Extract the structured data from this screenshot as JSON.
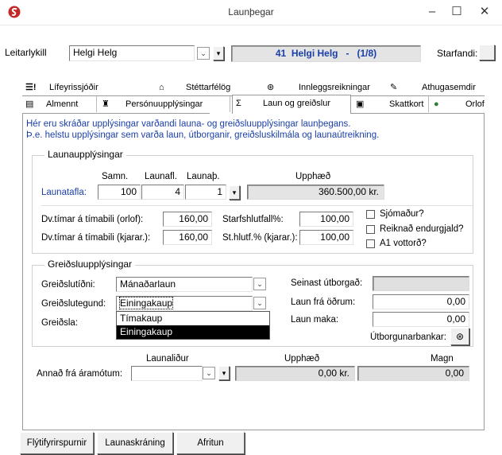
{
  "window": {
    "title": "Launþegar",
    "minimize": "–",
    "maximize": "☐",
    "close": "✕"
  },
  "search": {
    "label": "Leitarlykill",
    "value": "Helgi Helg",
    "current": "41  Helgi Helg   -   (1/8)",
    "status_label": "Starfandi:"
  },
  "tabs_row1": [
    {
      "label": "Lífeyrissjóðir",
      "icon": "pension-icon"
    },
    {
      "label": "Stéttarfélög",
      "icon": "union-icon"
    },
    {
      "label": "Innleggsreikningar",
      "icon": "deposit-icon"
    },
    {
      "label": "Athugasemdir",
      "icon": "notes-icon"
    }
  ],
  "tabs_row2": [
    {
      "label": "Almennt",
      "icon": "general-icon"
    },
    {
      "label": "Persónuupplýsingar",
      "icon": "person-icon"
    },
    {
      "label": "Laun og greiðslur",
      "icon": "sigma-icon",
      "glyph": "Σ"
    },
    {
      "label": "Skattkort",
      "icon": "taxcard-icon"
    },
    {
      "label": "Orlof",
      "icon": "globe-icon"
    }
  ],
  "info": {
    "line1": "Hér eru skráðar upplýsingar varðandi launa- og greiðsluupplýsingar launþegans.",
    "line2": "Þ.e. helstu upplýsingar sem varða laun, útborganir, greiðsluskilmála og launaútreikning."
  },
  "wage": {
    "title": "Launaupplýsingar",
    "col_samn": "Samn.",
    "col_launafl": "Launafl.",
    "col_launath": "Launaþ.",
    "col_upphaed": "Upphæð",
    "row_label": "Launatafla:",
    "samn": "100",
    "launafl": "4",
    "launath": "1",
    "upphaed": "360.500,00 kr.",
    "dv_orlof_label": "Dv.tímar á tímabili (orlof):",
    "dv_orlof": "160,00",
    "dv_kjarar_label": "Dv.tímar á tímabili (kjarar.):",
    "dv_kjarar": "160,00",
    "starfshlutfall_label": "Starfshlutfall%:",
    "starfshlutfall": "100,00",
    "sthlutf_label": "St.hlutf.% (kjarar.):",
    "sthlutf": "100,00",
    "chk_sjomadur": "Sjómaður?",
    "chk_reiknad": "Reiknað endurgjald?",
    "chk_a1": "A1 vottorð?"
  },
  "payment": {
    "title": "Greiðsluupplýsingar",
    "tidni_label": "Greiðslutíðni:",
    "tidni_value": "Mánaðarlaun",
    "tegund_label": "Greiðslutegund:",
    "tegund_value": "Einingakaup",
    "greidsla_label": "Greiðsla:",
    "options": [
      "Tímakaup",
      "Einingakaup"
    ],
    "seinast_label": "Seinast útborgað:",
    "seinast_value": "",
    "laun_fra_label": "Laun frá öðrum:",
    "laun_fra_value": "0,00",
    "laun_maka_label": "Laun maka:",
    "laun_maka_value": "0,00",
    "banks_label": "Útborgunarbankar:"
  },
  "carry": {
    "col_launalidur": "Launaliður",
    "col_upphaed": "Upphæð",
    "col_magn": "Magn",
    "label": "Annað frá áramótum:",
    "launalidur": "",
    "upphaed": "0,00 kr.",
    "magn": "0,00"
  },
  "buttons": {
    "shortcuts": "Flýtifyrirspurnir",
    "payroll": "Launaskráning",
    "copy": "Afritun"
  }
}
